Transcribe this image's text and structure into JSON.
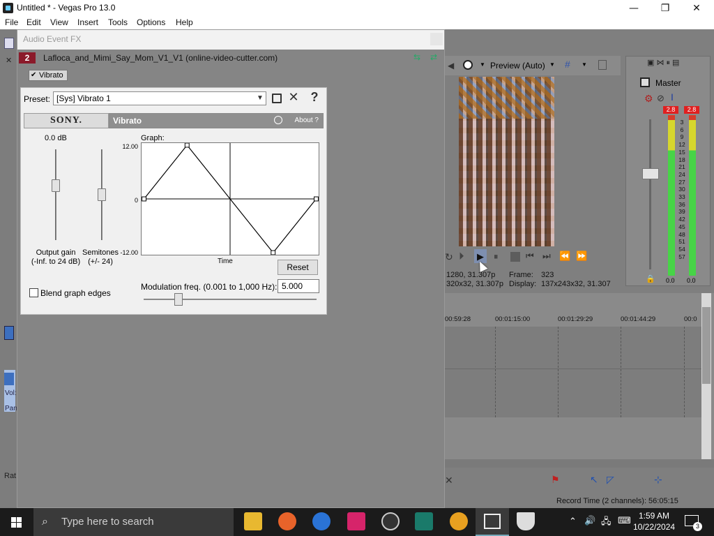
{
  "window": {
    "title": "Untitled * - Vegas Pro 13.0",
    "minimize": "—",
    "maximize": "❐",
    "close": "✕"
  },
  "menu": [
    "File",
    "Edit",
    "View",
    "Insert",
    "Tools",
    "Options",
    "Help"
  ],
  "fx_window": {
    "title": "Audio Event FX",
    "chain_number": "2",
    "chain_name": "Lafloca_and_Mimi_Say_Mom_V1_V1 (online-video-cutter.com)",
    "plugin_tab": "Vibrato",
    "preset_label": "Preset:",
    "preset_value": "[Sys] Vibrato 1",
    "vendor": "SONY.",
    "plugin_title": "Vibrato",
    "about": "About  ?",
    "gain_value": "0.0 dB",
    "output_gain_label": "Output gain\n(-Inf. to 24 dB)",
    "semitones_label": "Semitones\n(+/- 24)",
    "graph_label": "Graph:",
    "graph_max": "12.00",
    "graph_zero": "0",
    "graph_min": "-12.00",
    "time_label": "Time",
    "reset": "Reset",
    "blend_label": "Blend graph edges",
    "blend_checked": false,
    "mod_label": "Modulation freq. (0.001 to 1,000 Hz):",
    "mod_value": "5.000",
    "output_gain_level": 0.6,
    "semitones_level": 0.5,
    "mod_level": 0.2,
    "graph_points": [
      [
        0,
        0
      ],
      [
        0.25,
        12
      ],
      [
        0.75,
        -12
      ],
      [
        1,
        0
      ]
    ]
  },
  "preview": {
    "mode": "Preview (Auto)",
    "info_line1_left": "1280, 31.307p",
    "info_line1_mid": "Frame:",
    "info_line1_right": "323",
    "info_line2_left": "320x32, 31.307p",
    "info_line2_mid": "Display:",
    "info_line2_right": "137x243x32, 31.307"
  },
  "master": {
    "label": "Master",
    "peak_l": "2.8",
    "peak_r": "2.8",
    "scale": [
      "3",
      "6",
      "9",
      "12",
      "15",
      "18",
      "21",
      "24",
      "27",
      "30",
      "33",
      "36",
      "39",
      "42",
      "45",
      "48",
      "51",
      "54",
      "57"
    ],
    "bottom_l": "0.0",
    "bottom_r": "0.0"
  },
  "timeline": {
    "ticks": [
      "00:59:28",
      "00:01:15:00",
      "00:01:29:29",
      "00:01:44:29",
      "00:0"
    ],
    "record_time": "Record Time (2 channels): 56:05:15"
  },
  "left_strip": {
    "vol": "Vol:",
    "pan": "Pan",
    "rate": "Rat"
  },
  "taskbar": {
    "search_placeholder": "Type here to search",
    "time": "1:59 AM",
    "date": "10/22/2024",
    "notifications": "3"
  },
  "colors": {
    "accent_red": "#e02020",
    "chain_badge": "#8b1a2a",
    "taskbar": "#1b1b1b"
  }
}
